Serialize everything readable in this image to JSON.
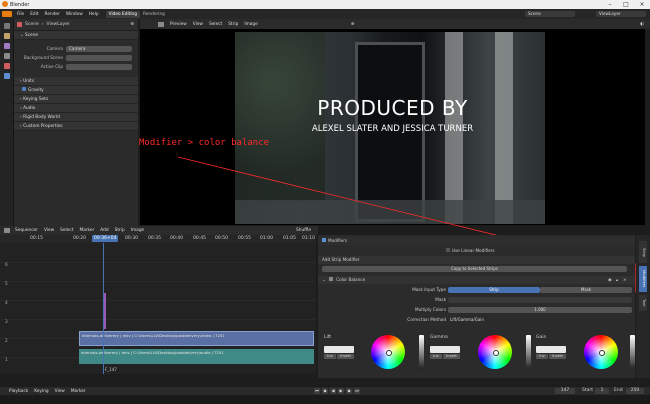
{
  "window": {
    "title": "Blender"
  },
  "menubar": {
    "items": [
      "File",
      "Edit",
      "Render",
      "Window",
      "Help"
    ],
    "workspace_tabs": [
      "Video Editing",
      "Rendering"
    ],
    "scene": "Scene",
    "view_layer": "ViewLayer"
  },
  "left_panel": {
    "scene_label": "Scene",
    "viewlayer_label": "ViewLayer",
    "scene_section": "Scene",
    "fields": [
      {
        "label": "Camera",
        "value": "Camera"
      },
      {
        "label": "Background Scene",
        "value": ""
      },
      {
        "label": "Active Clip",
        "value": ""
      }
    ],
    "units_section": "Units",
    "gravity_label": "Gravity",
    "sections": [
      "Keying Sets",
      "Audio",
      "Rigid Body World",
      "Custom Properties"
    ]
  },
  "preview": {
    "header_items": [
      "Preview",
      "View",
      "Select",
      "Strip",
      "Image"
    ],
    "title": "PRODUCED BY",
    "subtitle": "ALEXEL SLATER AND JESSICA TURNER"
  },
  "annotation": {
    "text": "Modifier > color balance",
    "color": "#ff2a2a"
  },
  "sequencer": {
    "header_items": [
      "Sequencer",
      "View",
      "Select",
      "Marker",
      "Add",
      "Strip",
      "Image"
    ],
    "snap": "Shuffle",
    "ruler_ticks": [
      "00:15",
      "00:20",
      "00:30",
      "00:35",
      "00:40",
      "00:45",
      "00:50",
      "00:55",
      "01:00",
      "01:05",
      "01:10"
    ],
    "current_time": "00:36+04",
    "channels": [
      "6",
      "5",
      "4",
      "3",
      "2",
      "1"
    ],
    "strips": [
      {
        "text": "intervals-deliverery | mkv | C:\\Users\\LLV\\Desktop\\postdelivery\\video | 7251",
        "color": "#5a6fa3"
      },
      {
        "text": "intervals-deliverery | mkv | C:\\Users\\LLV\\Desktop\\postdelivery\\audio | 7251",
        "color": "#3f8a86"
      }
    ],
    "frame_marker": "F_147"
  },
  "modifiers": {
    "header": "Modifiers",
    "use_linear": "Use Linear Modifiers",
    "add_strip": "Add Strip Modifier",
    "copy_button": "Copy to Selected Strips",
    "color_balance": "Color Balance",
    "mask_input_type": "Mask Input Type",
    "mask_options": [
      "Strip",
      "Mask"
    ],
    "mask_label": "Mask",
    "multiply_label": "Multiply Colors",
    "multiply_value": "1.000",
    "correction_label": "Correction Method",
    "correction_value": "Lift/Gamma/Gain",
    "wheels": [
      {
        "label": "Lift",
        "btn1": "Inv",
        "btn2": "Invert"
      },
      {
        "label": "Gamma",
        "btn1": "Inv",
        "btn2": "Invert"
      },
      {
        "label": "Gain",
        "btn1": "Inv",
        "btn2": "Invert"
      }
    ],
    "side_tabs": [
      "Strip",
      "Modifiers",
      "Tool"
    ]
  },
  "playback": {
    "items": [
      "Playback",
      "Keying",
      "View",
      "Marker"
    ],
    "frame": "147",
    "start": "Start",
    "start_val": "1",
    "end": "End",
    "end_val": "250"
  }
}
